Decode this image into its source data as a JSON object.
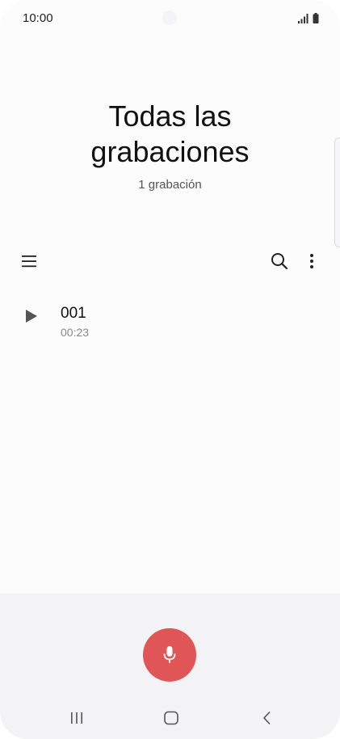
{
  "status_bar": {
    "time": "10:00",
    "icons": [
      "signal-icon",
      "battery-icon"
    ]
  },
  "header": {
    "title": "Todas las grabaciones",
    "subtitle": "1 grabación"
  },
  "toolbar": {
    "icons": [
      "menu-icon",
      "search-icon",
      "more-vertical-icon"
    ]
  },
  "recordings": [
    {
      "name": "001",
      "duration": "00:23",
      "icon": "play-icon"
    }
  ],
  "bottom": {
    "record_icon": "microphone-icon",
    "nav_icons": [
      "recents-icon",
      "home-icon",
      "back-icon"
    ]
  },
  "colors": {
    "background": "#fcfcfd",
    "record_button": "#e05656",
    "bottom_panel": "#f3f3f5",
    "primary_text": "#111111",
    "secondary_text": "#8a8a8e"
  }
}
